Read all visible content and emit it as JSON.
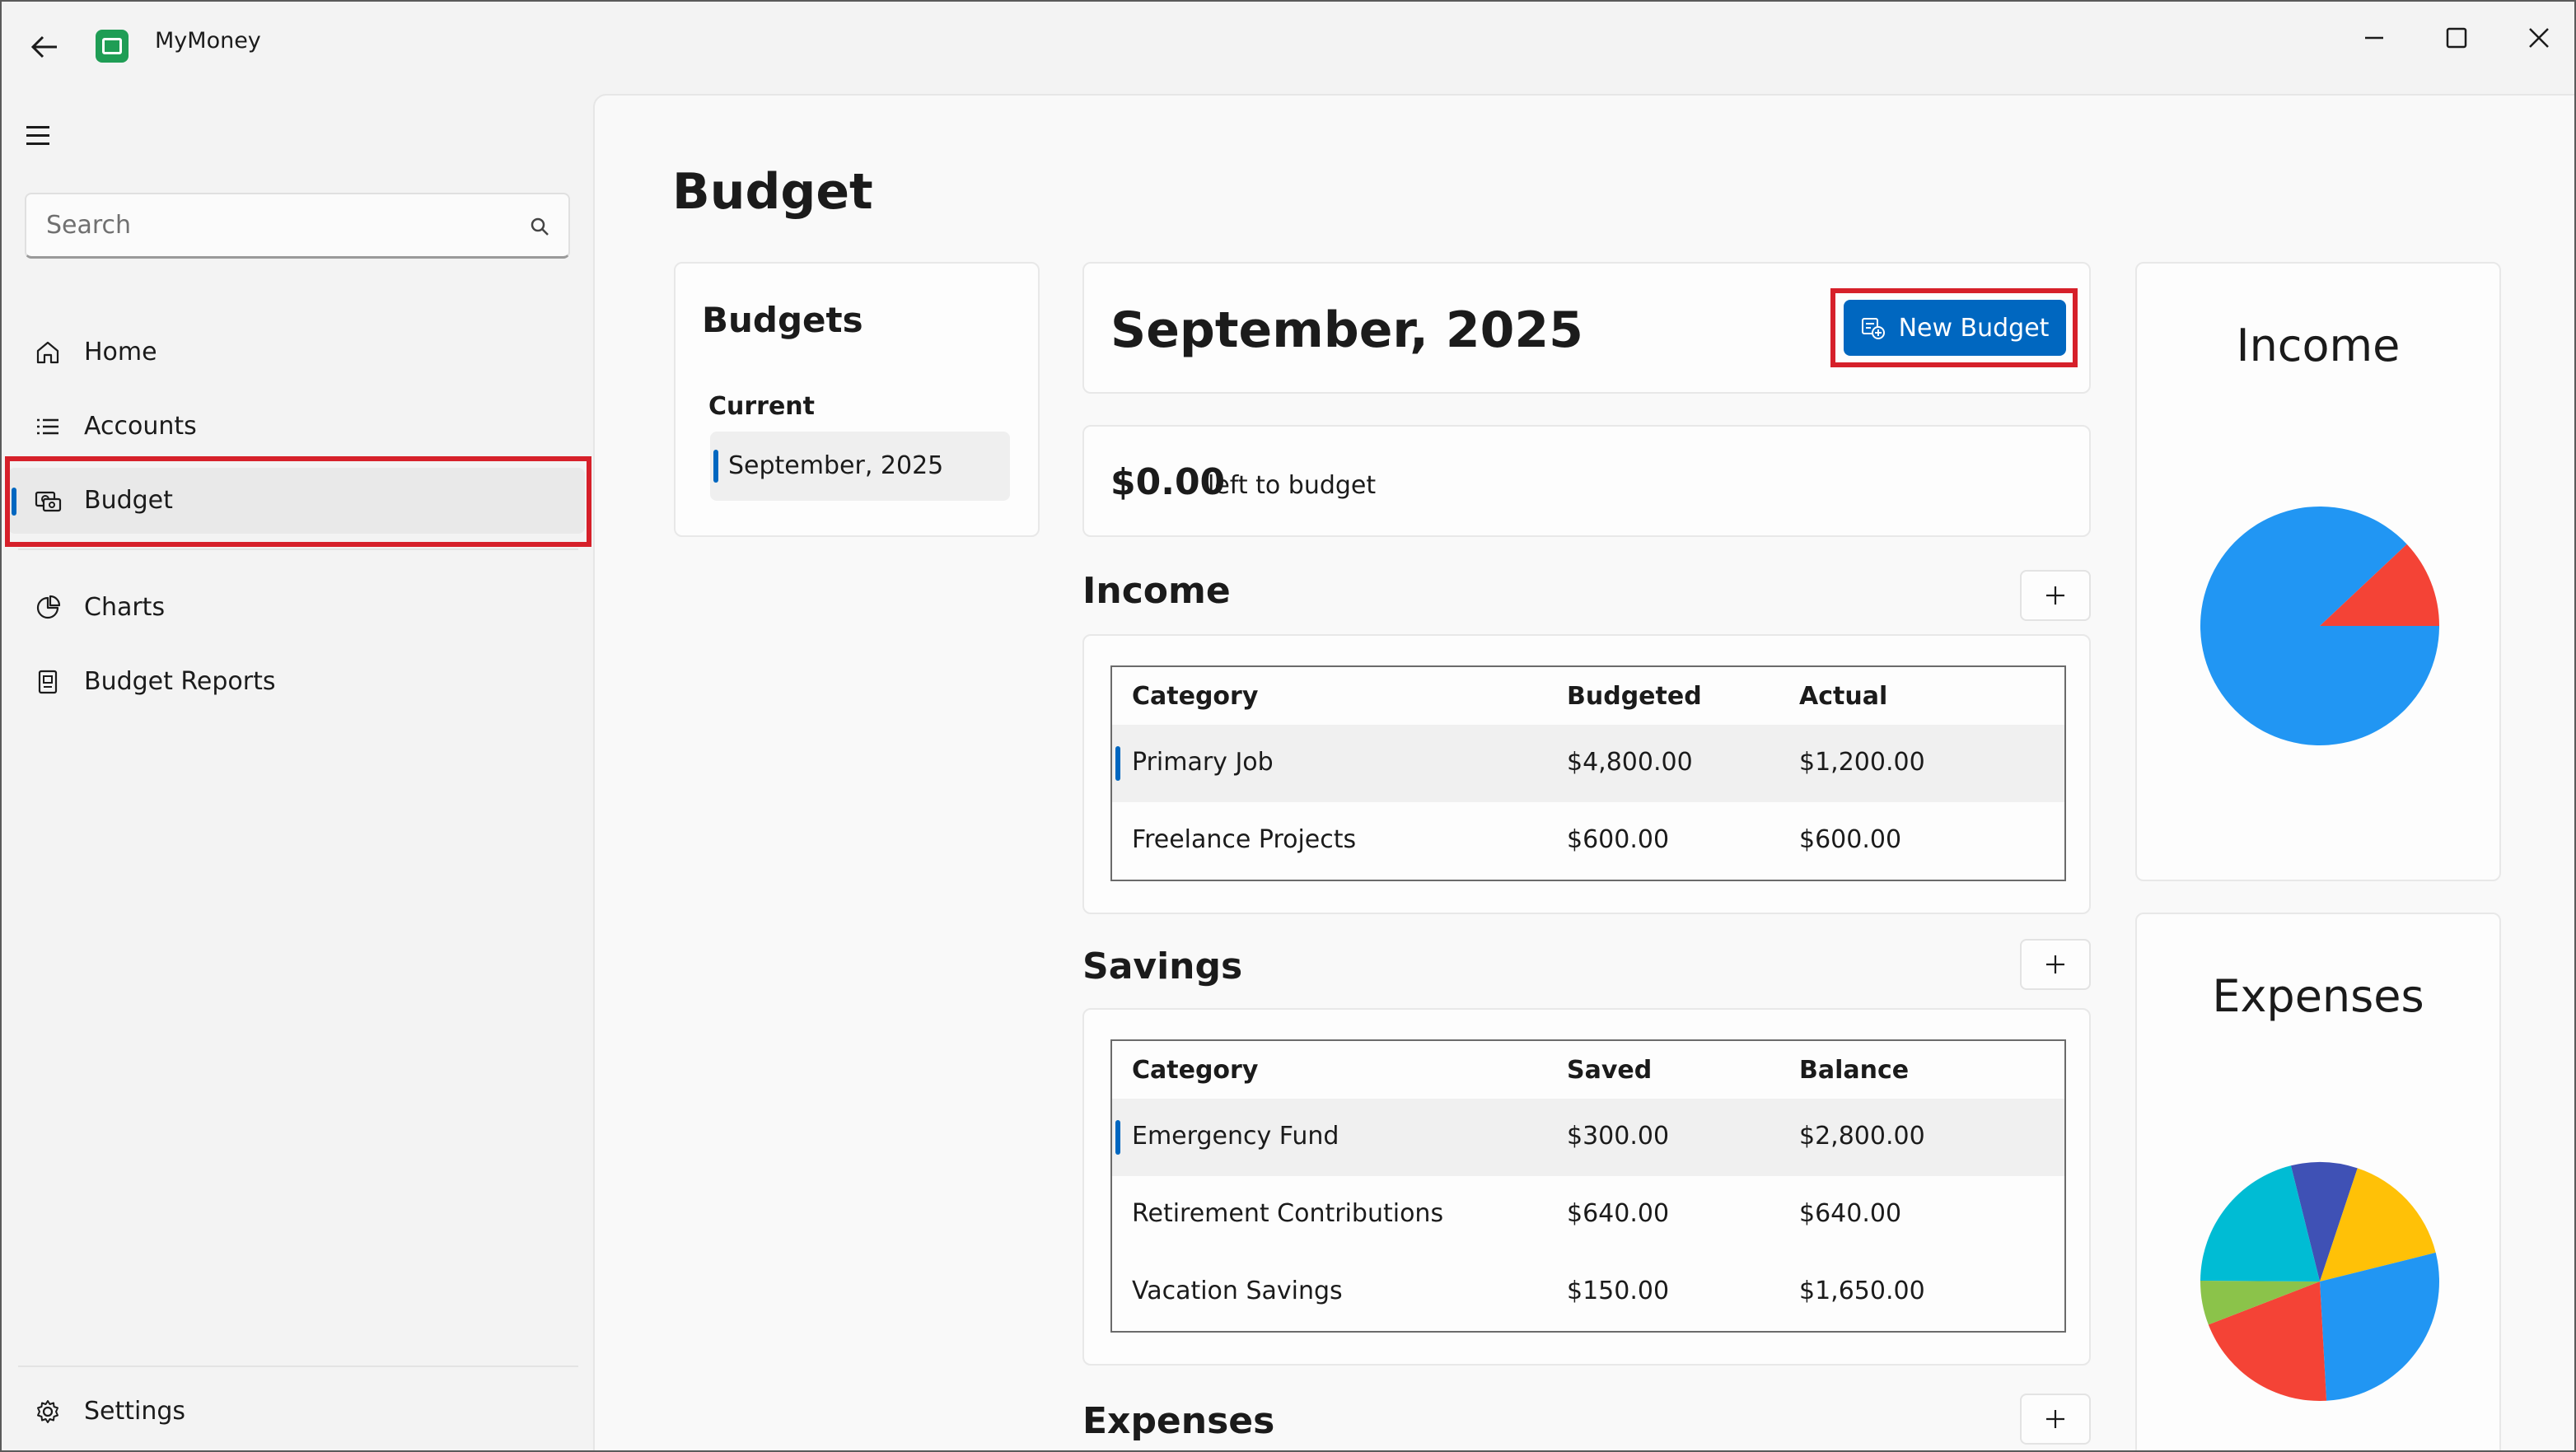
{
  "window": {
    "app_title": "MyMoney"
  },
  "sidebar": {
    "search_placeholder": "Search",
    "items": [
      {
        "label": "Home"
      },
      {
        "label": "Accounts"
      },
      {
        "label": "Budget"
      },
      {
        "label": "Charts"
      },
      {
        "label": "Budget Reports"
      }
    ],
    "settings_label": "Settings"
  },
  "page": {
    "title": "Budget"
  },
  "budgets_panel": {
    "title": "Budgets",
    "current_label": "Current",
    "current_item": "September, 2025"
  },
  "month_panel": {
    "title": "September, 2025",
    "new_budget_label": "New Budget"
  },
  "left_to_budget": {
    "amount": "$0.00",
    "label": "left to budget"
  },
  "income": {
    "title": "Income",
    "columns": [
      "Category",
      "Budgeted",
      "Actual"
    ],
    "rows": [
      [
        "Primary Job",
        "$4,800.00",
        "$1,200.00"
      ],
      [
        "Freelance Projects",
        "$600.00",
        "$600.00"
      ]
    ]
  },
  "savings": {
    "title": "Savings",
    "columns": [
      "Category",
      "Saved",
      "Balance"
    ],
    "rows": [
      [
        "Emergency Fund",
        "$300.00",
        "$2,800.00"
      ],
      [
        "Retirement Contributions",
        "$640.00",
        "$640.00"
      ],
      [
        "Vacation Savings",
        "$150.00",
        "$1,650.00"
      ]
    ]
  },
  "expenses": {
    "title": "Expenses"
  },
  "chart_data": [
    {
      "type": "pie",
      "title": "Income",
      "values": [
        88,
        12
      ],
      "colors": [
        "#2196f3",
        "#f44336"
      ]
    },
    {
      "type": "pie",
      "title": "Expenses",
      "values": [
        9,
        16,
        28,
        20,
        6,
        21
      ],
      "colors": [
        "#3f51b5",
        "#ffc107",
        "#2196f3",
        "#f44336",
        "#8bc34a",
        "#00bcd4"
      ]
    }
  ]
}
